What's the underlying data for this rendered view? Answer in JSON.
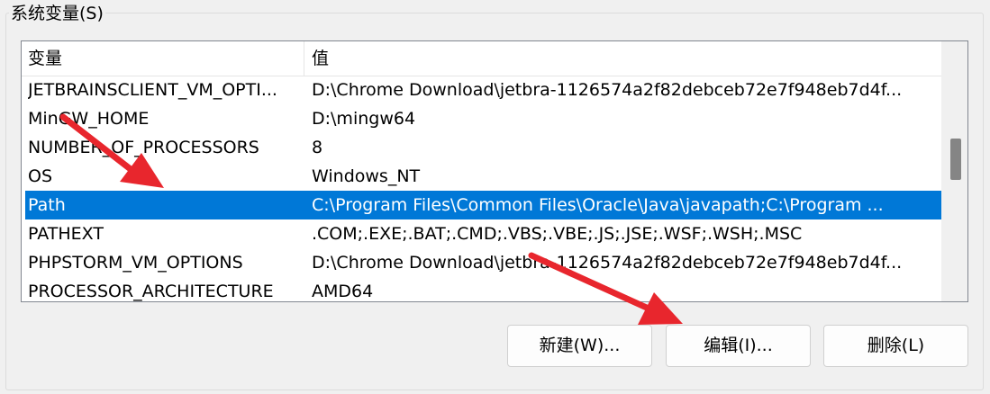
{
  "group": {
    "title": "系统变量(S)"
  },
  "list": {
    "columns": [
      "变量",
      "值"
    ],
    "rows": [
      {
        "name": "JETBRAINSCLIENT_VM_OPTI...",
        "value": "D:\\Chrome Download\\jetbra-1126574a2f82debceb72e7f948eb7d4f...",
        "selected": false
      },
      {
        "name": "MinGW_HOME",
        "value": "D:\\mingw64",
        "selected": false
      },
      {
        "name": "NUMBER_OF_PROCESSORS",
        "value": "8",
        "selected": false
      },
      {
        "name": "OS",
        "value": "Windows_NT",
        "selected": false
      },
      {
        "name": "Path",
        "value": "C:\\Program Files\\Common Files\\Oracle\\Java\\javapath;C:\\Program ...",
        "selected": true
      },
      {
        "name": "PATHEXT",
        "value": ".COM;.EXE;.BAT;.CMD;.VBS;.VBE;.JS;.JSE;.WSF;.WSH;.MSC",
        "selected": false
      },
      {
        "name": "PHPSTORM_VM_OPTIONS",
        "value": "D:\\Chrome Download\\jetbra-1126574a2f82debceb72e7f948eb7d4f...",
        "selected": false
      },
      {
        "name": "PROCESSOR_ARCHITECTURE",
        "value": "AMD64",
        "selected": false
      }
    ]
  },
  "buttons": {
    "new": "新建(W)...",
    "edit": "编辑(I)...",
    "delete": "删除(L)"
  },
  "colors": {
    "selection": "#0078d7",
    "annotation_arrow": "#e8262d"
  }
}
